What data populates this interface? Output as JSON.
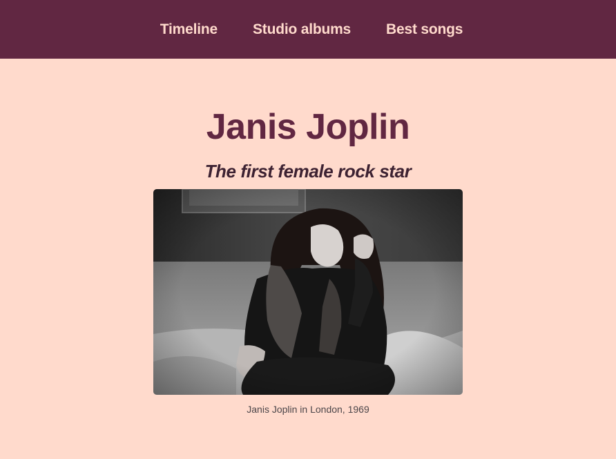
{
  "nav": {
    "items": [
      {
        "label": "Timeline"
      },
      {
        "label": "Studio albums"
      },
      {
        "label": "Best songs"
      }
    ]
  },
  "header": {
    "title": "Janis Joplin",
    "subtitle": "The first female rock star"
  },
  "figure": {
    "caption": "Janis Joplin in London, 1969"
  },
  "colors": {
    "nav_background": "#612742",
    "page_background": "#ffdacc",
    "title": "#612742"
  }
}
